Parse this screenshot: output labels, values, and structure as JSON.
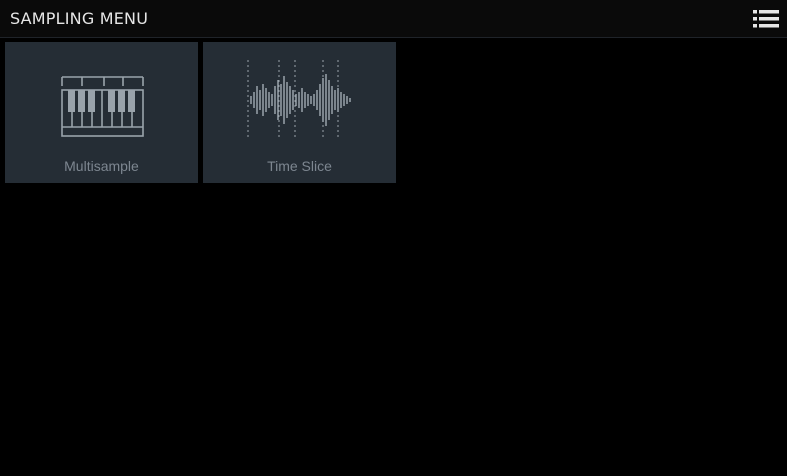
{
  "header": {
    "title": "SAMPLING MENU",
    "menu_icon": "list-menu-icon"
  },
  "tiles": [
    {
      "label": "Multisample",
      "icon": "piano-keyboard-icon"
    },
    {
      "label": "Time Slice",
      "icon": "waveform-slice-icon"
    }
  ],
  "colors": {
    "background": "#000000",
    "tile_background": "#252d35",
    "icon": "#9aa3ab",
    "label": "#7d8690",
    "title": "#e6e6e6"
  }
}
